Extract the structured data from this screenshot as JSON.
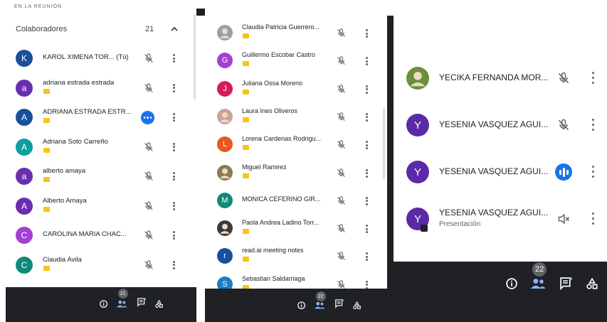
{
  "panel1": {
    "section_caption": "EN LA REUNIÓN",
    "header_label": "Colaboradores",
    "header_count": "21",
    "participants": [
      {
        "initial": "K",
        "name": "KAROL XIMENA TOR... (Tú)",
        "color": "#1a4f9c",
        "badge": false,
        "mic": "off"
      },
      {
        "initial": "a",
        "name": "adriana estrada estrada",
        "color": "#6a2eb0",
        "badge": true,
        "mic": "off"
      },
      {
        "initial": "A",
        "name": "ADRIANA ESTRADA ESTR...",
        "color": "#1a4f9c",
        "badge": true,
        "mic": "more"
      },
      {
        "initial": "A",
        "name": "Adriana Soto Carreño",
        "color": "#0f9da0",
        "badge": true,
        "mic": "off"
      },
      {
        "initial": "a",
        "name": "alberto amaya",
        "color": "#6a2eb0",
        "badge": true,
        "mic": "off"
      },
      {
        "initial": "A",
        "name": "Alberto Amaya",
        "color": "#6a2eb0",
        "badge": true,
        "mic": "off"
      },
      {
        "initial": "C",
        "name": "CAROLINA MARIA CHAC...",
        "color": "#a33fd2",
        "badge": false,
        "mic": "off"
      },
      {
        "initial": "C",
        "name": "Claudia Avila",
        "color": "#0f8a7a",
        "badge": true,
        "mic": "off"
      }
    ],
    "bar_count": "21"
  },
  "panel2": {
    "participants": [
      {
        "initial": "",
        "name": "Claudia Patricia Guerrero...",
        "color": "#9aa0a6",
        "photo": true,
        "badge": true
      },
      {
        "initial": "G",
        "name": "Guillermo Escobar Castro",
        "color": "#a33fd2",
        "photo": false,
        "badge": true
      },
      {
        "initial": "J",
        "name": "Juliana Ossa Moreno",
        "color": "#d81b60",
        "photo": false,
        "badge": true
      },
      {
        "initial": "",
        "name": "Laura Ines Oliveros",
        "color": "#c8a49a",
        "photo": true,
        "badge": true
      },
      {
        "initial": "L",
        "name": "Lorena Cardenas Rodrigu...",
        "color": "#e8591a",
        "photo": false,
        "badge": true
      },
      {
        "initial": "",
        "name": "Miguel Ramirez",
        "color": "#8a7a55",
        "photo": true,
        "badge": true
      },
      {
        "initial": "M",
        "name": "MONICA CEFERINO GIR...",
        "color": "#0f8a7a",
        "photo": false,
        "badge": false
      },
      {
        "initial": "",
        "name": "Paola Andrea Ladino Torr...",
        "color": "#3a3a3a",
        "photo": true,
        "badge": true
      },
      {
        "initial": "r",
        "name": "read.ai meeting notes",
        "color": "#1a4f9c",
        "photo": false,
        "badge": true
      },
      {
        "initial": "S",
        "name": "Sebastian Saldarriaga",
        "color": "#1a7fc1",
        "photo": false,
        "badge": true
      }
    ],
    "bar_count": "22"
  },
  "panel3": {
    "participants": [
      {
        "initial": "",
        "name": "YECIKA FERNANDA MOR...",
        "subtitle": "",
        "color": "#6b8f3a",
        "photo": true,
        "mic": "off"
      },
      {
        "initial": "Y",
        "name": "YESENIA VASQUEZ AGUI...",
        "subtitle": "",
        "color": "#5a2aa8",
        "photo": false,
        "mic": "off"
      },
      {
        "initial": "Y",
        "name": "YESENIA VASQUEZ AGUI...",
        "subtitle": "",
        "color": "#5a2aa8",
        "photo": false,
        "mic": "speaking"
      },
      {
        "initial": "Y",
        "name": "YESENIA VASQUEZ AGUI...",
        "subtitle": "Presentación",
        "color": "#5a2aa8",
        "photo": false,
        "mic": "muted-volume"
      }
    ],
    "bar_count": "22"
  },
  "colors": {
    "bar_bg": "#1f2124",
    "accent_blue": "#8ab4f8",
    "speaking_blue": "#1a73e8",
    "badge_yellow": "#f5c518"
  }
}
